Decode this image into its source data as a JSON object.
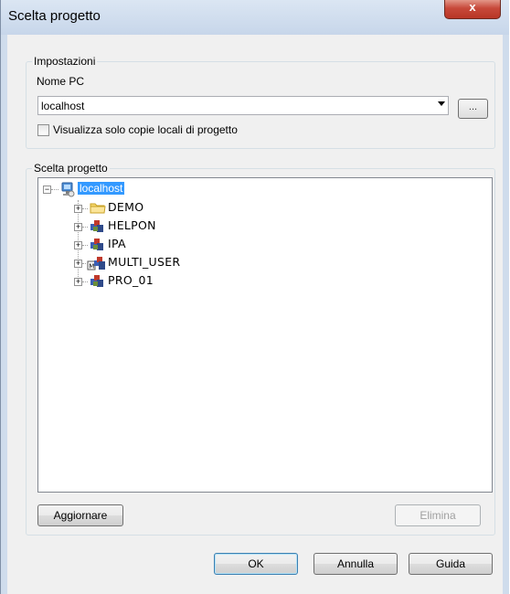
{
  "window": {
    "title": "Scelta progetto",
    "close_glyph": "x"
  },
  "settings_group": {
    "title": "Impostazioni",
    "pc_name_label": "Nome PC",
    "pc_name_value": "localhost",
    "browse_label": "...",
    "local_only_label": "Visualizza solo copie locali di progetto",
    "local_only_checked": false
  },
  "project_group": {
    "title": "Scelta progetto",
    "tree": {
      "root": {
        "label": "localhost",
        "icon": "computer-icon",
        "expanded": true,
        "selected": true
      },
      "children": [
        {
          "label": "DEMO",
          "icon": "folder-icon"
        },
        {
          "label": "HELPON",
          "icon": "project-icon"
        },
        {
          "label": "IPA",
          "icon": "project-icon"
        },
        {
          "label": "MULTI_USER",
          "icon": "multiuser-project-icon"
        },
        {
          "label": "PRO_01",
          "icon": "project-icon"
        }
      ]
    },
    "refresh_label": "Aggiornare",
    "delete_label": "Elimina"
  },
  "buttons": {
    "ok_label": "OK",
    "cancel_label": "Annulla",
    "help_label": "Guida"
  },
  "colors": {
    "selection": "#3399ff",
    "client_bg": "#f0f0f0",
    "close_button": "#c7493a"
  }
}
